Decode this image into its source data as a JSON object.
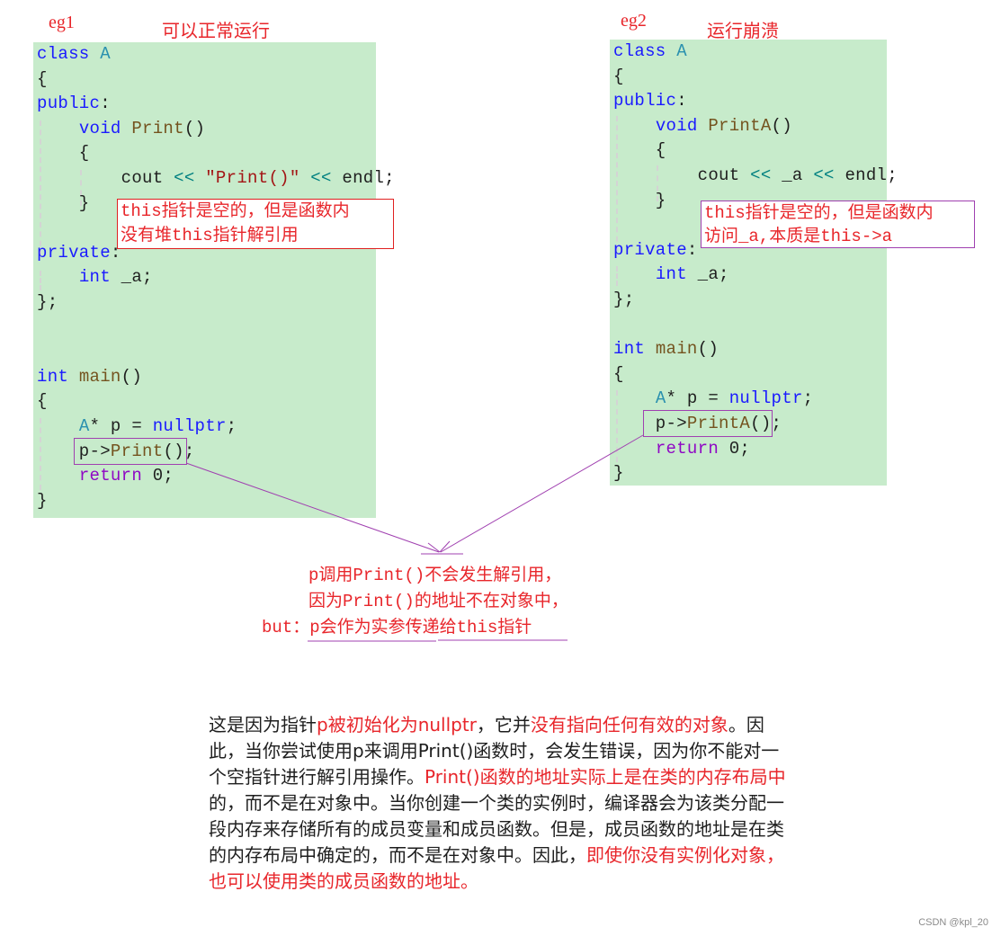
{
  "example1": {
    "tag": "eg1",
    "verdict": "可以正常运行",
    "code": [
      {
        "tokens": [
          [
            "kw",
            "class "
          ],
          [
            "type",
            "A"
          ]
        ]
      },
      {
        "tokens": [
          [
            "plain",
            "{"
          ]
        ]
      },
      {
        "tokens": [
          [
            "kw",
            "public"
          ],
          [
            "plain",
            ":"
          ]
        ]
      },
      {
        "tokens": [
          [
            "plain",
            "    "
          ],
          [
            "kw",
            "void "
          ],
          [
            "fn",
            "Print"
          ],
          [
            "plain",
            "()"
          ]
        ]
      },
      {
        "tokens": [
          [
            "plain",
            "    {"
          ]
        ]
      },
      {
        "tokens": [
          [
            "plain",
            "        cout "
          ],
          [
            "op",
            "<< "
          ],
          [
            "str",
            "\"Print()\""
          ],
          [
            "op",
            " << "
          ],
          [
            "plain",
            "endl;"
          ]
        ]
      },
      {
        "tokens": [
          [
            "plain",
            "    }"
          ]
        ]
      },
      {
        "tokens": []
      },
      {
        "tokens": [
          [
            "kw",
            "private"
          ],
          [
            "plain",
            ":"
          ]
        ]
      },
      {
        "tokens": [
          [
            "plain",
            "    "
          ],
          [
            "kw",
            "int "
          ],
          [
            "plain",
            "_a;"
          ]
        ]
      },
      {
        "tokens": [
          [
            "plain",
            "};"
          ]
        ]
      },
      {
        "tokens": []
      },
      {
        "tokens": []
      },
      {
        "tokens": [
          [
            "kw",
            "int "
          ],
          [
            "fn",
            "main"
          ],
          [
            "plain",
            "()"
          ]
        ]
      },
      {
        "tokens": [
          [
            "plain",
            "{"
          ]
        ]
      },
      {
        "tokens": [
          [
            "plain",
            "    "
          ],
          [
            "type",
            "A"
          ],
          [
            "plain",
            "* p = "
          ],
          [
            "kw",
            "nullptr"
          ],
          [
            "plain",
            ";"
          ]
        ]
      },
      {
        "tokens": [
          [
            "plain",
            "    p->"
          ],
          [
            "fn",
            "Print"
          ],
          [
            "plain",
            "();"
          ]
        ]
      },
      {
        "tokens": [
          [
            "plain",
            "    "
          ],
          [
            "ctl",
            "return "
          ],
          [
            "num",
            "0;"
          ]
        ]
      },
      {
        "tokens": [
          [
            "plain",
            "}"
          ]
        ]
      }
    ],
    "note": [
      "this指针是空的，但是函数内",
      "没有堆this指针解引用"
    ]
  },
  "example2": {
    "tag": "eg2",
    "verdict": "运行崩溃",
    "code": [
      {
        "tokens": [
          [
            "kw",
            "class "
          ],
          [
            "type",
            "A"
          ]
        ]
      },
      {
        "tokens": [
          [
            "plain",
            "{"
          ]
        ]
      },
      {
        "tokens": [
          [
            "kw",
            "public"
          ],
          [
            "plain",
            ":"
          ]
        ]
      },
      {
        "tokens": [
          [
            "plain",
            "    "
          ],
          [
            "kw",
            "void "
          ],
          [
            "fn",
            "PrintA"
          ],
          [
            "plain",
            "()"
          ]
        ]
      },
      {
        "tokens": [
          [
            "plain",
            "    {"
          ]
        ]
      },
      {
        "tokens": [
          [
            "plain",
            "        cout "
          ],
          [
            "op",
            "<< "
          ],
          [
            "plain",
            "_a"
          ],
          [
            "op",
            " << "
          ],
          [
            "plain",
            "endl;"
          ]
        ]
      },
      {
        "tokens": [
          [
            "plain",
            "    }"
          ]
        ]
      },
      {
        "tokens": []
      },
      {
        "tokens": [
          [
            "kw",
            "private"
          ],
          [
            "plain",
            ":"
          ]
        ]
      },
      {
        "tokens": [
          [
            "plain",
            "    "
          ],
          [
            "kw",
            "int "
          ],
          [
            "plain",
            "_a;"
          ]
        ]
      },
      {
        "tokens": [
          [
            "plain",
            "};"
          ]
        ]
      },
      {
        "tokens": []
      },
      {
        "tokens": [
          [
            "kw",
            "int "
          ],
          [
            "fn",
            "main"
          ],
          [
            "plain",
            "()"
          ]
        ]
      },
      {
        "tokens": [
          [
            "plain",
            "{"
          ]
        ]
      },
      {
        "tokens": [
          [
            "plain",
            "    "
          ],
          [
            "type",
            "A"
          ],
          [
            "plain",
            "* p = "
          ],
          [
            "kw",
            "nullptr"
          ],
          [
            "plain",
            ";"
          ]
        ]
      },
      {
        "tokens": [
          [
            "plain",
            "    p->"
          ],
          [
            "fn",
            "PrintA"
          ],
          [
            "plain",
            "();"
          ]
        ]
      },
      {
        "tokens": [
          [
            "plain",
            "    "
          ],
          [
            "ctl",
            "return "
          ],
          [
            "num",
            "0;"
          ]
        ]
      },
      {
        "tokens": [
          [
            "plain",
            "}"
          ]
        ]
      }
    ],
    "note": [
      "this指针是空的，但是函数内",
      "访问_a,本质是this->a"
    ]
  },
  "center_note": {
    "line1": "p调用Print()不会发生解引用，",
    "line2": "因为Print()的地址不在对象中，",
    "line3_prefix": "but：",
    "line3_main": "p会作为实参传递给this指针"
  },
  "explanation": [
    {
      "t": "这是因为指针",
      "hl": false
    },
    {
      "t": "p被初始化为nullptr",
      "hl": true
    },
    {
      "t": "，它并",
      "hl": false
    },
    {
      "t": "没有指向任何有效的对象",
      "hl": true
    },
    {
      "t": "。因此，当你尝试使用p来调用Print()函数时，会发生错误，因为你不能对一个空指针进行解引用操作。",
      "hl": false
    },
    {
      "t": "Print()函数的地址实际上是在类的内存布局中",
      "hl": true
    },
    {
      "t": "的，而不是在对象中。当你创建一个类的实例时，编译器会为该类分配一段内存来存储所有的成员变量和成员函数。但是，成员函数的地址是在类的内存布局中确定的，而不是在对象中。因此，",
      "hl": false
    },
    {
      "t": "即使你没有实例化对象，也可以使用类的成员函数的地址。",
      "hl": true
    }
  ],
  "watermark": "CSDN @kpl_20",
  "colors": {
    "code_bg": "#c7ebcb",
    "annotation_red": "#e8262b",
    "arrow_purple": "#a040b0"
  }
}
